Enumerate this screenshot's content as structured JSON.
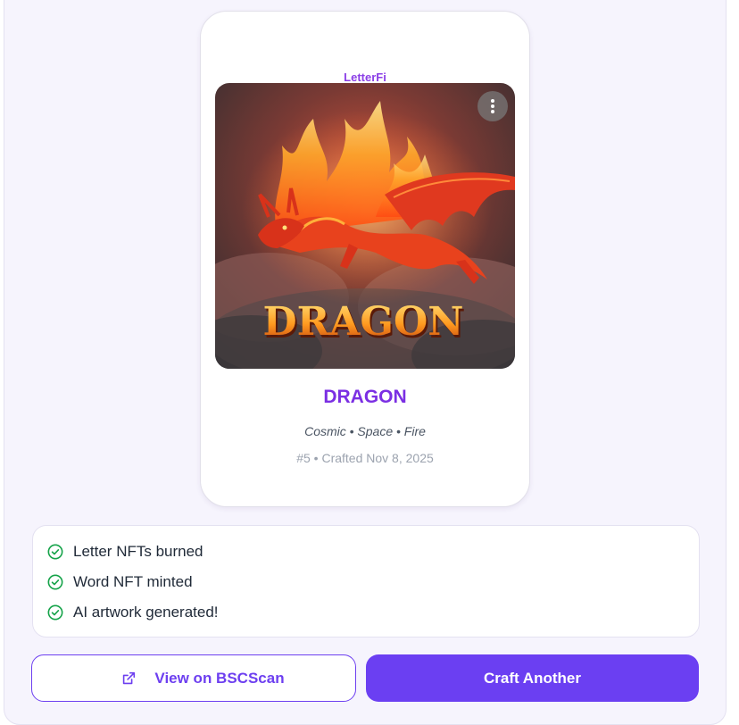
{
  "card": {
    "brand": "LetterFi",
    "artwork_text": "DRAGON",
    "title": "DRAGON",
    "tags": "Cosmic • Space • Fire",
    "meta": "#5 • Crafted Nov 8, 2025",
    "menu_icon": "more-vertical-icon"
  },
  "status": {
    "items": [
      {
        "label": "Letter NFTs burned",
        "icon": "check-circle-icon"
      },
      {
        "label": "Word NFT minted",
        "icon": "check-circle-icon"
      },
      {
        "label": "AI artwork generated!",
        "icon": "check-circle-icon"
      }
    ]
  },
  "actions": {
    "view_label": "View on BSCScan",
    "view_icon": "external-link-icon",
    "craft_label": "Craft Another"
  },
  "colors": {
    "accent": "#6b3ff2",
    "title": "#7b2fe3",
    "success": "#16a34a",
    "panel_bg": "#f6f4fd"
  }
}
